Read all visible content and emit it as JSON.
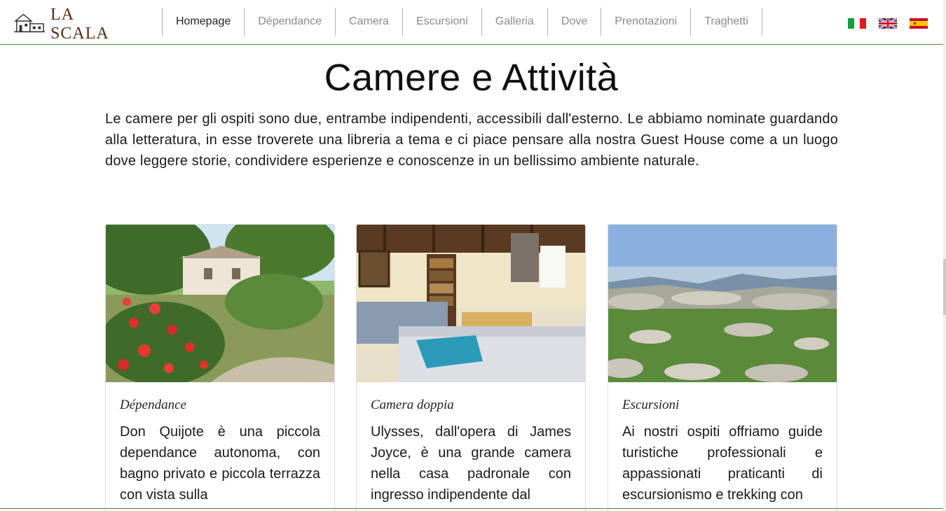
{
  "brand": {
    "logo_text": "LA SCALA"
  },
  "nav": {
    "items": [
      {
        "label": "Homepage"
      },
      {
        "label": "Dépendance"
      },
      {
        "label": "Camera"
      },
      {
        "label": "Escursioni"
      },
      {
        "label": "Galleria"
      },
      {
        "label": "Dove"
      },
      {
        "label": "Prenotazioni"
      },
      {
        "label": "Traghetti"
      }
    ],
    "active": "Homepage"
  },
  "languages": [
    "italian-flag-icon",
    "uk-flag-icon",
    "spain-flag-icon"
  ],
  "main": {
    "title": "Camere e Attività",
    "intro": "Le camere per gli ospiti sono due, entrambe indipendenti, accessibili dall'esterno. Le abbiamo nominate guardando alla letteratura, in esse troverete una libreria a tema e ci piace pensare alla nostra Guest House come a un luogo dove leggere storie, condividere esperienze e conoscenze in un bellissimo ambiente naturale."
  },
  "cards": [
    {
      "title": "Dépendance",
      "text": "Don Quijote è una piccola dependance autonoma, con bagno privato e piccola terrazza con vista sulla"
    },
    {
      "title": "Camera doppia",
      "text": "Ulysses, dall'opera di James Joyce, è una grande camera nella casa padronale con ingresso indipendente dal"
    },
    {
      "title": "Escursioni",
      "text": "Ai nostri ospiti offriamo guide turistiche professionali e appassionati praticanti di escursionismo e trekking con"
    }
  ],
  "colors": {
    "accent": "#4a8a3a",
    "brand": "#5a2a10"
  }
}
